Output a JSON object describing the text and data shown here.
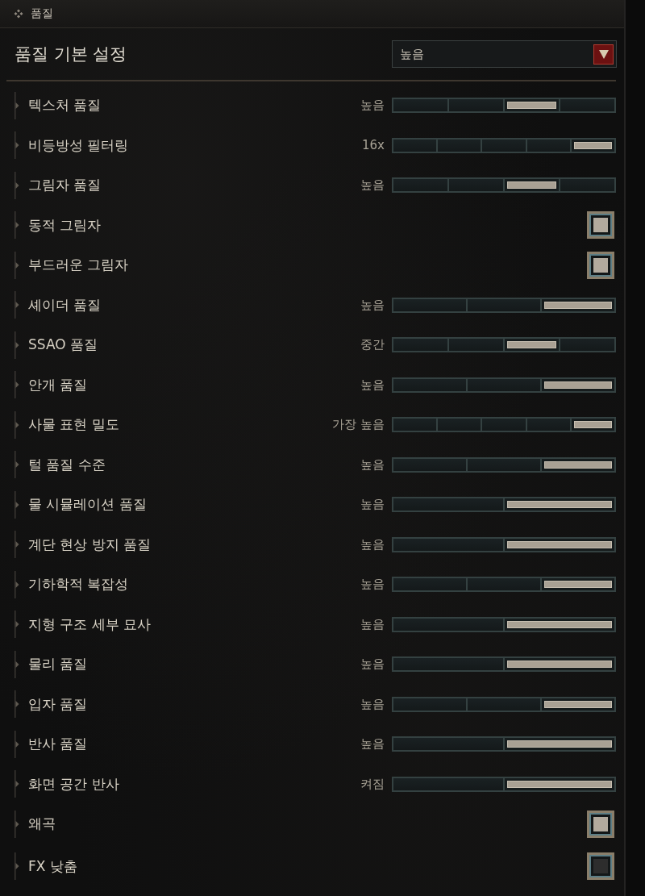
{
  "panel": {
    "title": "품질"
  },
  "preset": {
    "label": "품질 기본 설정",
    "value": "높음"
  },
  "rows": [
    {
      "kind": "slider",
      "label": "텍스처 품질",
      "value": "높음",
      "segments": [
        {
          "selected": false
        },
        {
          "selected": false
        },
        {
          "selected": true
        },
        {
          "selected": false
        }
      ]
    },
    {
      "kind": "slider",
      "label": "비등방성 필터링",
      "value": "16x",
      "segments": [
        {
          "selected": false
        },
        {
          "selected": false
        },
        {
          "selected": false
        },
        {
          "selected": false
        },
        {
          "selected": true
        }
      ]
    },
    {
      "kind": "slider",
      "label": "그림자 품질",
      "value": "높음",
      "segments": [
        {
          "selected": false
        },
        {
          "selected": false
        },
        {
          "selected": true
        },
        {
          "selected": false
        }
      ]
    },
    {
      "kind": "checkbox",
      "label": "동적 그림자",
      "checked": true
    },
    {
      "kind": "checkbox",
      "label": "부드러운 그림자",
      "checked": true
    },
    {
      "kind": "slider",
      "label": "셰이더 품질",
      "value": "높음",
      "segments": [
        {
          "selected": false
        },
        {
          "selected": false
        },
        {
          "selected": true
        }
      ]
    },
    {
      "kind": "slider",
      "label": "SSAO 품질",
      "value": "중간",
      "segments": [
        {
          "selected": false
        },
        {
          "selected": false
        },
        {
          "selected": true
        },
        {
          "selected": false
        }
      ]
    },
    {
      "kind": "slider",
      "label": "안개 품질",
      "value": "높음",
      "segments": [
        {
          "selected": false
        },
        {
          "selected": false
        },
        {
          "selected": true
        }
      ]
    },
    {
      "kind": "slider",
      "label": "사물 표현 밀도",
      "value": "가장 높음",
      "segments": [
        {
          "selected": false
        },
        {
          "selected": false
        },
        {
          "selected": false
        },
        {
          "selected": false
        },
        {
          "selected": true
        }
      ]
    },
    {
      "kind": "slider",
      "label": "털 품질 수준",
      "value": "높음",
      "segments": [
        {
          "selected": false
        },
        {
          "selected": false
        },
        {
          "selected": true
        }
      ]
    },
    {
      "kind": "slider",
      "label": "물 시뮬레이션 품질",
      "value": "높음",
      "segments": [
        {
          "selected": false
        },
        {
          "selected": true
        }
      ]
    },
    {
      "kind": "slider",
      "label": "계단 현상 방지 품질",
      "value": "높음",
      "segments": [
        {
          "selected": false
        },
        {
          "selected": true
        }
      ]
    },
    {
      "kind": "slider",
      "label": "기하학적 복잡성",
      "value": "높음",
      "segments": [
        {
          "selected": false
        },
        {
          "selected": false
        },
        {
          "selected": true
        }
      ]
    },
    {
      "kind": "slider",
      "label": "지형 구조 세부 묘사",
      "value": "높음",
      "segments": [
        {
          "selected": false
        },
        {
          "selected": true
        }
      ]
    },
    {
      "kind": "slider",
      "label": "물리 품질",
      "value": "높음",
      "segments": [
        {
          "selected": false
        },
        {
          "selected": true
        }
      ]
    },
    {
      "kind": "slider",
      "label": "입자 품질",
      "value": "높음",
      "segments": [
        {
          "selected": false
        },
        {
          "selected": false
        },
        {
          "selected": true
        }
      ]
    },
    {
      "kind": "slider",
      "label": "반사 품질",
      "value": "높음",
      "segments": [
        {
          "selected": false
        },
        {
          "selected": true
        }
      ]
    },
    {
      "kind": "slider",
      "label": "화면 공간 반사",
      "value": "켜짐",
      "segments": [
        {
          "selected": false
        },
        {
          "selected": true
        }
      ]
    },
    {
      "kind": "checkbox",
      "label": "왜곡",
      "checked": true
    },
    {
      "kind": "checkbox",
      "label": "FX 낮춤",
      "checked": false
    }
  ]
}
